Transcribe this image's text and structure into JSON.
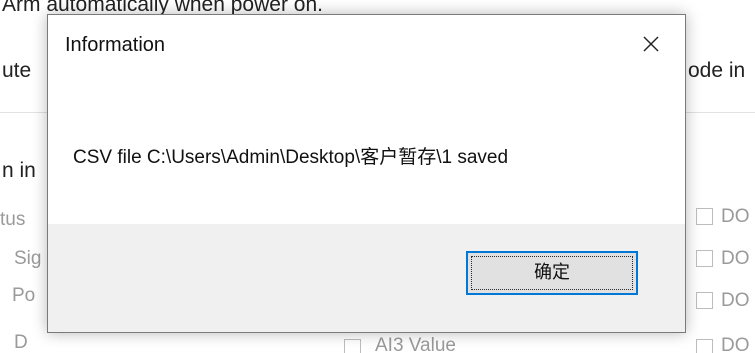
{
  "background": {
    "top_line": "Arm automatically when power on.",
    "row2_left": "ute",
    "row2_right": "ode in",
    "section_label": "n in",
    "rows_left": [
      "tus",
      "Sig",
      "Po",
      "D"
    ],
    "checkbox_labels": [
      "DO",
      "DO",
      "DO",
      "DO"
    ],
    "ai_checkbox_label": "AI3 Value"
  },
  "dialog": {
    "title": "Information",
    "close_glyph": "✕",
    "message": "CSV file C:\\Users\\Admin\\Desktop\\客户暂存\\1 saved",
    "ok_label": "确定"
  },
  "colors": {
    "accent_focus": "#0078d7",
    "footer_bg": "#f0f0f0",
    "button_bg": "#e1e1e1",
    "dim_text": "#9a9a9a"
  }
}
